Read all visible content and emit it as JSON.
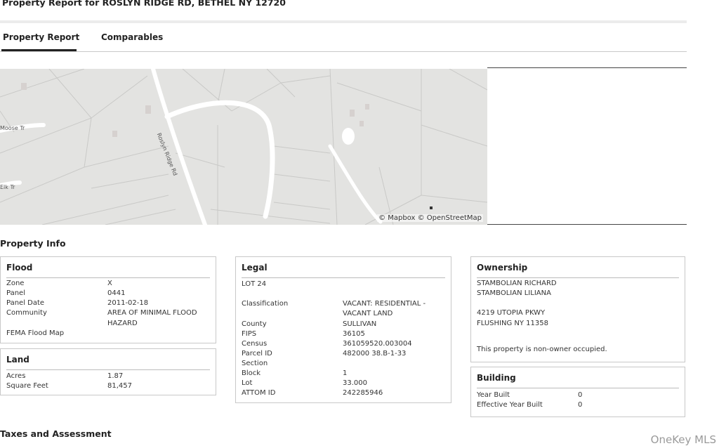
{
  "page": {
    "title": "Property Report for ROSLYN RIDGE RD, BETHEL NY 12720"
  },
  "tabs": [
    {
      "label": "Property Report",
      "active": true
    },
    {
      "label": "Comparables",
      "active": false
    }
  ],
  "map": {
    "credit": "© Mapbox © OpenStreetMap",
    "road_labels": [
      "Roslyn Ridge Rd",
      "Moose Tr",
      "Elk Tr"
    ]
  },
  "property_info": {
    "heading": "Property Info",
    "flood": {
      "title": "Flood",
      "zone_label": "Zone",
      "zone": "X",
      "panel_label": "Panel",
      "panel": "0441",
      "panel_date_label": "Panel Date",
      "panel_date": "2011-02-18",
      "community_label": "Community",
      "community_line1": "AREA OF MINIMAL FLOOD",
      "community_line2": "HAZARD",
      "fema_label": "FEMA Flood Map"
    },
    "land": {
      "title": "Land",
      "acres_label": "Acres",
      "acres": "1.87",
      "sqft_label": "Square Feet",
      "sqft": "81,457"
    },
    "legal": {
      "title": "Legal",
      "lot_desc": "LOT 24",
      "classification_label": "Classification",
      "classification_line1": "VACANT: RESIDENTIAL -",
      "classification_line2": "VACANT LAND",
      "county_label": "County",
      "county": "SULLIVAN",
      "fips_label": "FIPS",
      "fips": "36105",
      "census_label": "Census",
      "census": "361059520.003004",
      "parcel_label": "Parcel ID",
      "parcel": "482000 38.B-1-33",
      "section_label": "Section",
      "section": "",
      "block_label": "Block",
      "block": "1",
      "lot_label": "Lot",
      "lot": "33.000",
      "attom_label": "ATTOM ID",
      "attom": "242285946"
    },
    "ownership": {
      "title": "Ownership",
      "owner1": "STAMBOLIAN RICHARD",
      "owner2": "STAMBOLIAN LILIANA",
      "address1": "4219 UTOPIA PKWY",
      "address2": "FLUSHING NY 11358",
      "occupancy": "This property is non-owner occupied."
    },
    "building": {
      "title": "Building",
      "year_built_label": "Year Built",
      "year_built": "0",
      "eff_year_label": "Effective Year Built",
      "eff_year": "0"
    }
  },
  "taxes": {
    "heading": "Taxes and Assessment"
  },
  "watermark": "OneKey MLS"
}
